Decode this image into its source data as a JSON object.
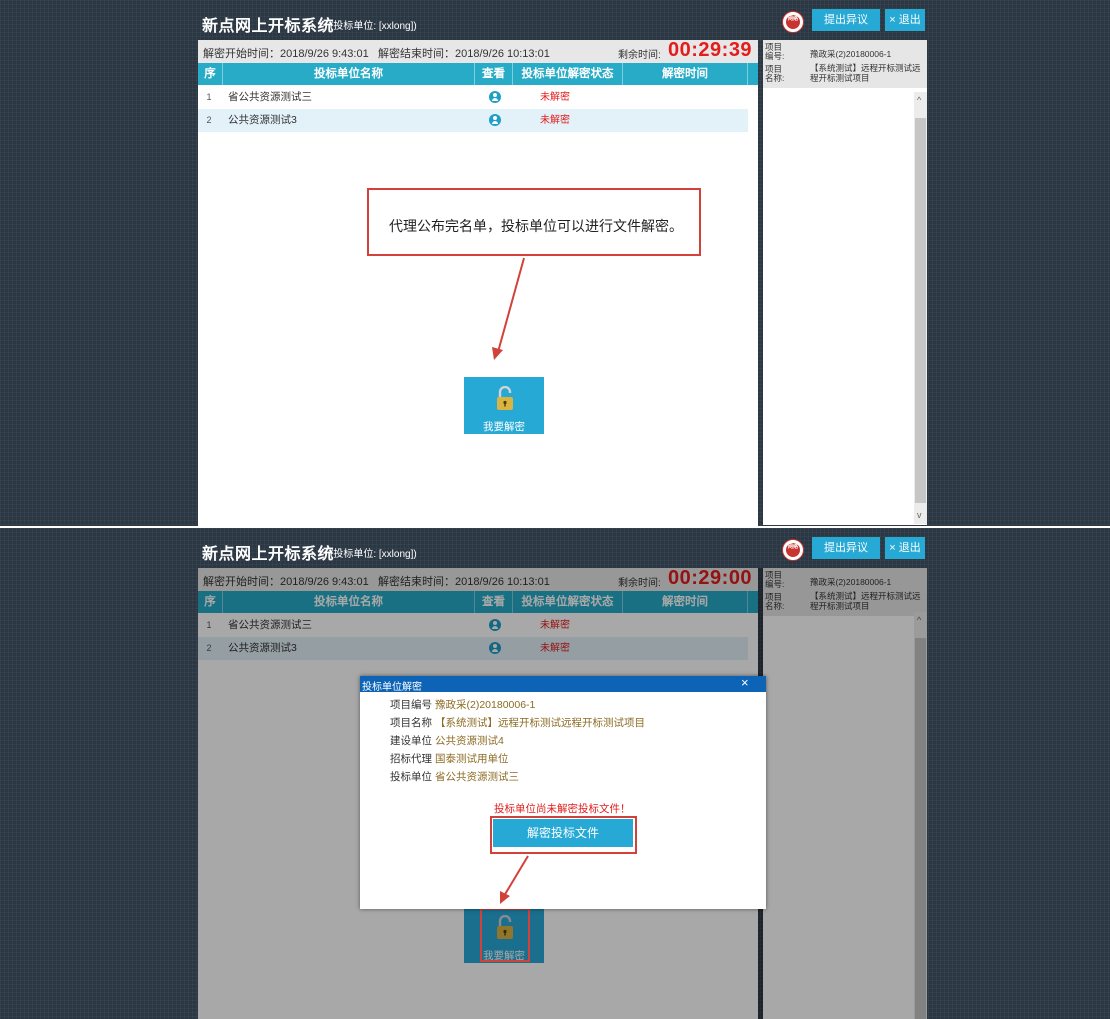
{
  "app": {
    "title": "新点网上开标系统",
    "bidder_label": "(投标单位:",
    "bidder_value": "[xxlong])",
    "logo_text": "网络\n广告",
    "btn_objection": "提出异议",
    "btn_exit": "× 退出"
  },
  "time": {
    "start": "解密开始时间：2018/9/26 9:43:01",
    "end": "解密结束时间：2018/9/26 10:13:01",
    "remaining_label": "剩余时间:",
    "remaining_top": "00:29:39",
    "remaining_bottom": "00:29:00"
  },
  "table": {
    "headers": [
      "序",
      "投标单位名称",
      "查看",
      "投标单位解密状态",
      "解密时间"
    ],
    "rows": [
      {
        "seq": "1",
        "name": "省公共资源测试三",
        "status": "未解密"
      },
      {
        "seq": "2",
        "name": "公共资源测试3",
        "status": "未解密"
      }
    ]
  },
  "side": {
    "project_no_label": "项目编号:",
    "project_no": "豫政采(2)20180006-1",
    "project_name_label": "项目名称:",
    "project_name": "【系统测试】远程开标测试远程开标测试项目"
  },
  "callout": {
    "text": "代理公布完名单，投标单位可以进行文件解密。"
  },
  "decrypt_button": {
    "label": "我要解密"
  },
  "modal": {
    "title": "投标单位解密",
    "close": "×",
    "fields": [
      {
        "label": "项目编号",
        "value": "豫政采(2)20180006-1"
      },
      {
        "label": "项目名称",
        "value": "【系统测试】远程开标测试远程开标测试项目"
      },
      {
        "label": "建设单位",
        "value": "公共资源测试4"
      },
      {
        "label": "招标代理",
        "value": "国泰测试用单位"
      },
      {
        "label": "投标单位",
        "value": "省公共资源测试三"
      }
    ],
    "warning": "投标单位尚未解密投标文件！",
    "button": "解密投标文件"
  },
  "colors": {
    "accent": "#27a9d6",
    "header": "#28abc7",
    "alert": "#e31c1c",
    "modal_title": "#0d63b6"
  }
}
